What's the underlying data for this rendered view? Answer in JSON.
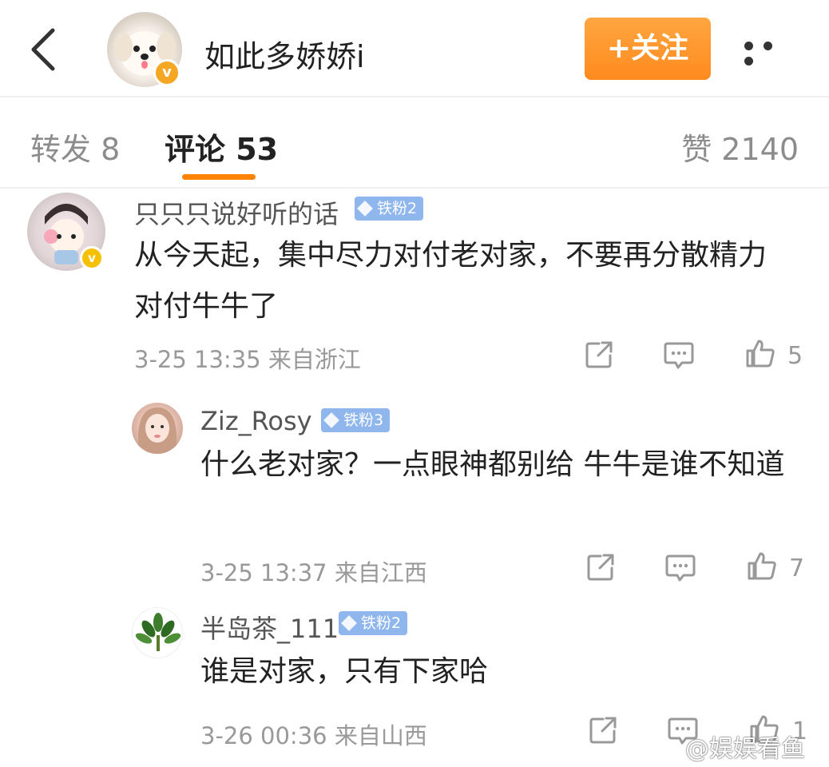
{
  "header": {
    "back_icon": "chevron-left-icon",
    "author_name": "如此多娇娇i",
    "verified_badge": "v",
    "follow_label": "+关注",
    "more_icon": "more-dots-icon",
    "accent_color": "#ff8200"
  },
  "tabs": {
    "repost": "转发 8",
    "comments": "评论 53",
    "likes": "赞 2140"
  },
  "comments": [
    {
      "user": "只只只说好听的话",
      "badge": "铁粉2",
      "verified": "v",
      "text": "从今天起，集中尽力对付老对家，不要再分散精力对付牛牛了",
      "meta": "3-25 13:35 来自浙江",
      "likes": "5"
    },
    {
      "user": "Ziz_Rosy",
      "badge": "铁粉3",
      "text": "什么老对家？一点眼神都别给 牛牛是谁不知道",
      "meta": "3-25 13:37 来自江西",
      "likes": "7"
    },
    {
      "user": "半岛茶_111",
      "badge": "铁粉2",
      "text": "谁是对家，只有下家哈",
      "meta": "3-26 00:36 来自山西",
      "likes": "1"
    }
  ],
  "watermark": "@娱娱看鱼"
}
